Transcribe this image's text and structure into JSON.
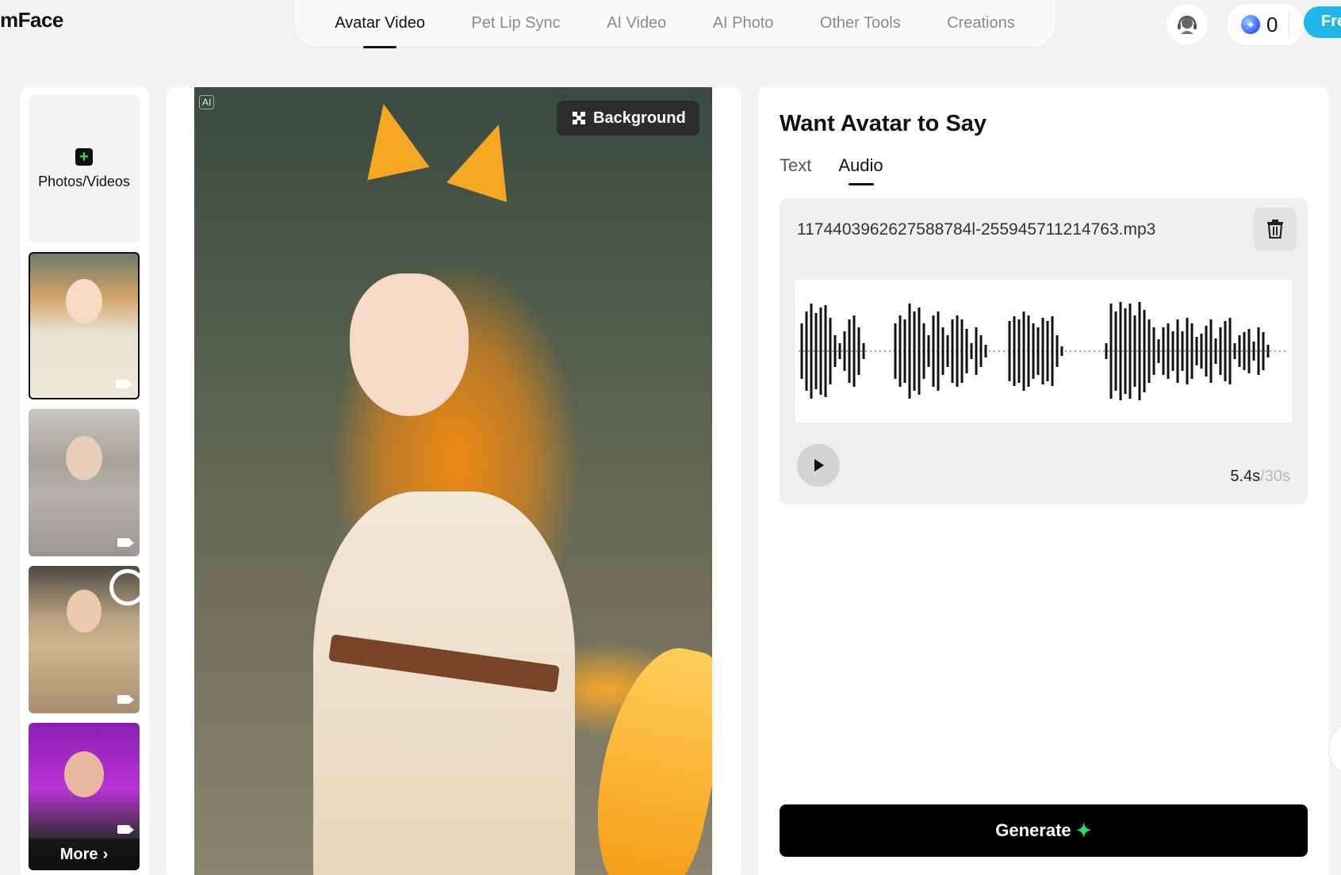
{
  "header": {
    "logo": "mFace",
    "nav": [
      {
        "label": "Avatar Video",
        "active": true
      },
      {
        "label": "Pet Lip Sync",
        "active": false
      },
      {
        "label": "AI Video",
        "active": false
      },
      {
        "label": "AI Photo",
        "active": false
      },
      {
        "label": "Other Tools",
        "active": false
      },
      {
        "label": "Creations",
        "active": false
      }
    ],
    "credits": "0",
    "free_label": "Fre"
  },
  "sidebar": {
    "upload_label": "Photos/Videos",
    "more_label": "More"
  },
  "preview": {
    "ai_badge": "AI",
    "background_label": "Background"
  },
  "panel": {
    "title": "Want Avatar to Say",
    "tabs": [
      {
        "label": "Text",
        "active": false
      },
      {
        "label": "Audio",
        "active": true
      }
    ],
    "audio": {
      "file_name": "1174403962627588784l-255945711214763.mp3",
      "duration": "5.4s",
      "max_duration": "/30s"
    },
    "generate_label": "Generate"
  },
  "colors": {
    "accent_green": "#27e06a",
    "free_button": "#1fb6e8",
    "text_primary": "#111111"
  }
}
